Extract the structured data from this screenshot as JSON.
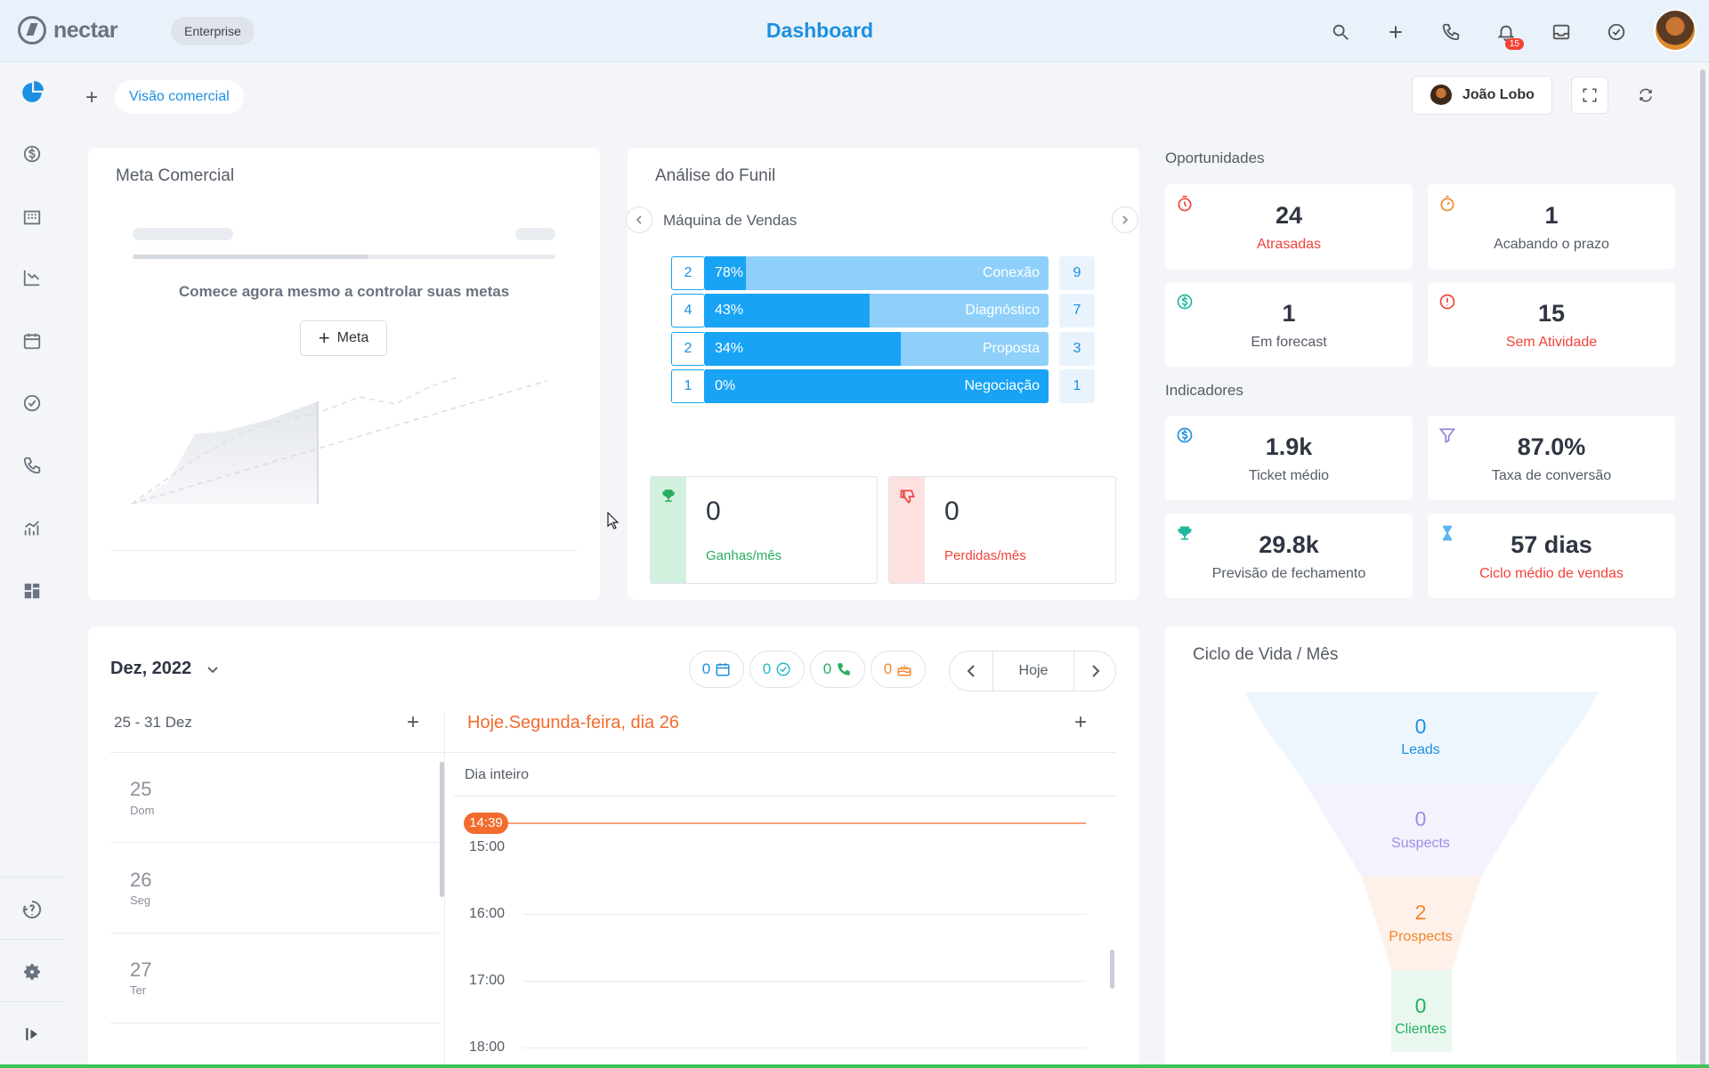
{
  "header": {
    "logo_text": "nectar",
    "plan_badge": "Enterprise",
    "title": "Dashboard",
    "notifications_count": "15",
    "icons": [
      "search-icon",
      "plus-icon",
      "phone-icon",
      "bell-icon",
      "inbox-icon",
      "check-circle-icon",
      "user-avatar"
    ]
  },
  "sidebar": {
    "items": [
      "dashboard-pie-icon",
      "money-icon",
      "companies-icon",
      "reports-icon",
      "calendar-icon",
      "tasks-icon",
      "calls-icon",
      "analytics-icon",
      "widgets-icon"
    ],
    "bottom": [
      "help-icon",
      "settings-icon",
      "expand-icon"
    ]
  },
  "toolbar": {
    "add_view": "+",
    "active_view": "Visão comercial",
    "user_name": "João Lobo"
  },
  "meta_comercial": {
    "title": "Meta Comercial",
    "empty_message": "Comece agora mesmo a controlar suas metas",
    "button_label": "Meta"
  },
  "funil": {
    "title": "Análise do Funil",
    "pipeline": "Máquina de Vendas",
    "stages": [
      {
        "count": "2",
        "percent": "78%",
        "name": "Conexão",
        "total": "9",
        "fill": 0.12
      },
      {
        "count": "4",
        "percent": "43%",
        "name": "Diagnóstico",
        "total": "7",
        "fill": 0.48
      },
      {
        "count": "2",
        "percent": "34%",
        "name": "Proposta",
        "total": "3",
        "fill": 0.57
      },
      {
        "count": "1",
        "percent": "0%",
        "name": "Negociação",
        "total": "1",
        "fill": 1.0
      }
    ],
    "won": {
      "value": "0",
      "label": "Ganhas/mês"
    },
    "lost": {
      "value": "0",
      "label": "Perdidas/mês"
    }
  },
  "oportunidades": {
    "title": "Oportunidades",
    "cards": [
      {
        "value": "24",
        "label": "Atrasadas",
        "icon": "alarm-icon"
      },
      {
        "value": "1",
        "label": "Acabando o prazo",
        "icon": "timer-icon"
      },
      {
        "value": "1",
        "label": "Em forecast",
        "icon": "dollar-icon"
      },
      {
        "value": "15",
        "label": "Sem Atividade",
        "icon": "alert-icon"
      }
    ]
  },
  "indicadores": {
    "title": "Indicadores",
    "cards": [
      {
        "value": "1.9k",
        "label": "Ticket médio",
        "icon": "dollar-icon"
      },
      {
        "value": "87.0%",
        "label": "Taxa de conversão",
        "icon": "filter-icon"
      },
      {
        "value": "29.8k",
        "label": "Previsão de fechamento",
        "icon": "trophy-icon"
      },
      {
        "value": "57 dias",
        "label": "Ciclo médio de vendas",
        "icon": "hourglass-icon"
      }
    ]
  },
  "agenda": {
    "month": "Dez, 2022",
    "chips": [
      {
        "value": "0",
        "icon": "calendar-icon",
        "color": "#1d8fe0"
      },
      {
        "value": "0",
        "icon": "check-icon",
        "color": "#22b8c9"
      },
      {
        "value": "0",
        "icon": "phone-icon",
        "color": "#27ae60"
      },
      {
        "value": "0",
        "icon": "cake-icon",
        "color": "#f5852a"
      }
    ],
    "today_button": "Hoje",
    "week_range": "25 - 31 Dez",
    "today_title": "Hoje.Segunda-feira, dia 26",
    "all_day": "Dia inteiro",
    "now_time": "14:39",
    "days": [
      {
        "num": "25",
        "weekday": "Dom"
      },
      {
        "num": "26",
        "weekday": "Seg"
      },
      {
        "num": "27",
        "weekday": "Ter"
      }
    ],
    "hours": [
      "15:00",
      "16:00",
      "17:00",
      "18:00"
    ]
  },
  "ciclo_vida": {
    "title": "Ciclo de Vida / Mês",
    "stages": [
      {
        "value": "0",
        "label": "Leads",
        "color": "#1d8fe0"
      },
      {
        "value": "0",
        "label": "Suspects",
        "color": "#9b8fe6"
      },
      {
        "value": "2",
        "label": "Prospects",
        "color": "#f5852a"
      },
      {
        "value": "0",
        "label": "Clientes",
        "color": "#27ae60"
      }
    ]
  }
}
